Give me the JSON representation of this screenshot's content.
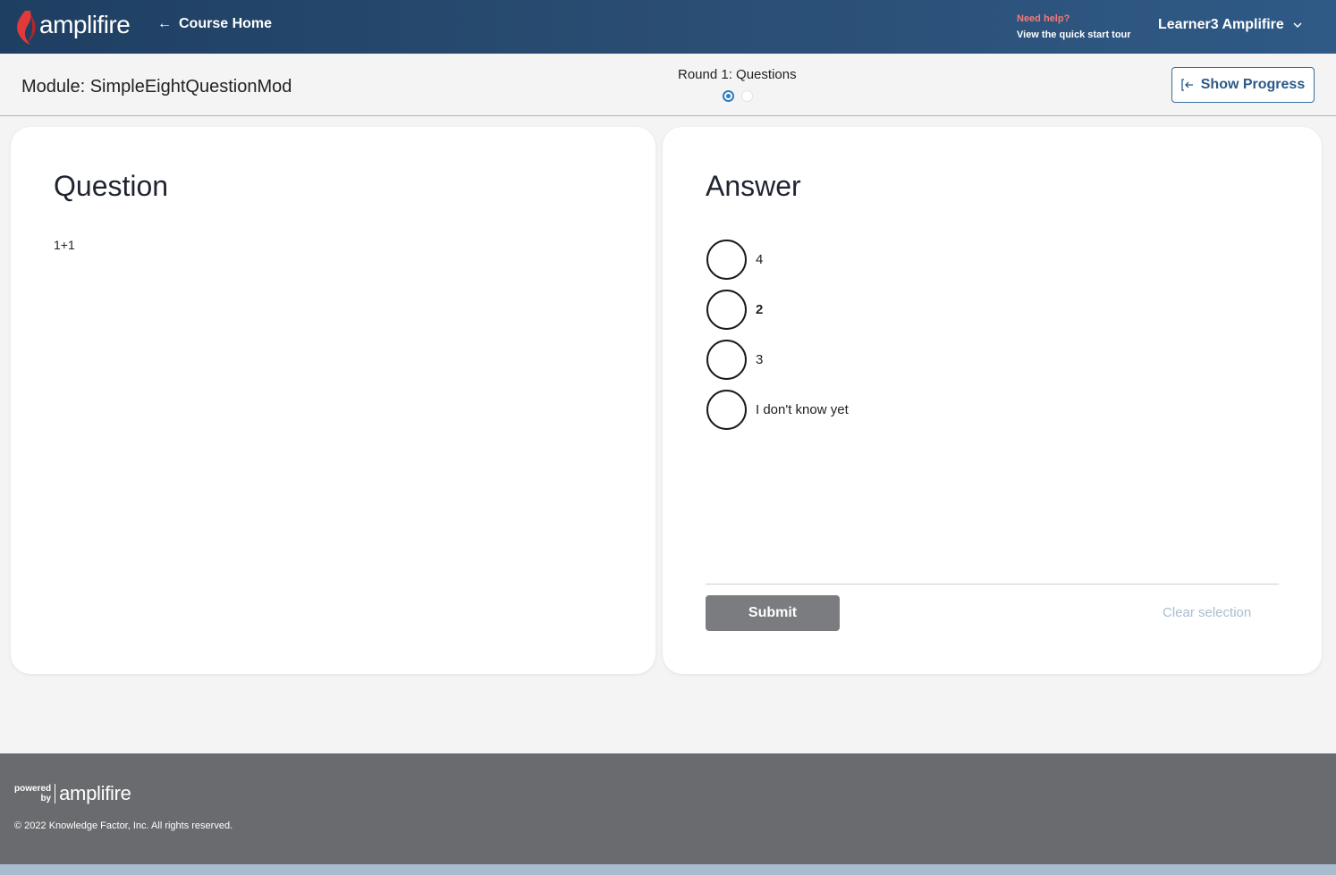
{
  "header": {
    "logo_text": "amplifire",
    "course_home_label": "Course Home",
    "help_title": "Need help?",
    "help_link": "View the quick start tour",
    "user_name": "Learner3 Amplifire"
  },
  "subheader": {
    "module_title": "Module: SimpleEightQuestionMod",
    "round_label": "Round 1: Questions",
    "show_progress_label": "Show Progress"
  },
  "question": {
    "heading": "Question",
    "text": "1+1"
  },
  "answer": {
    "heading": "Answer",
    "options": [
      {
        "label": "4"
      },
      {
        "label": "2"
      },
      {
        "label": "3"
      },
      {
        "label": "I don't know yet"
      }
    ],
    "submit_label": "Submit",
    "clear_label": "Clear selection"
  },
  "footer": {
    "powered_line1": "powered",
    "powered_line2": "by",
    "brand": "amplifire",
    "copyright": "© 2022 Knowledge Factor, Inc. All rights reserved."
  },
  "colors": {
    "accent": "#2a7bbf",
    "brand_red": "#e23a3a",
    "navbar": "#2a4d73",
    "footer": "#6a6b6f"
  }
}
